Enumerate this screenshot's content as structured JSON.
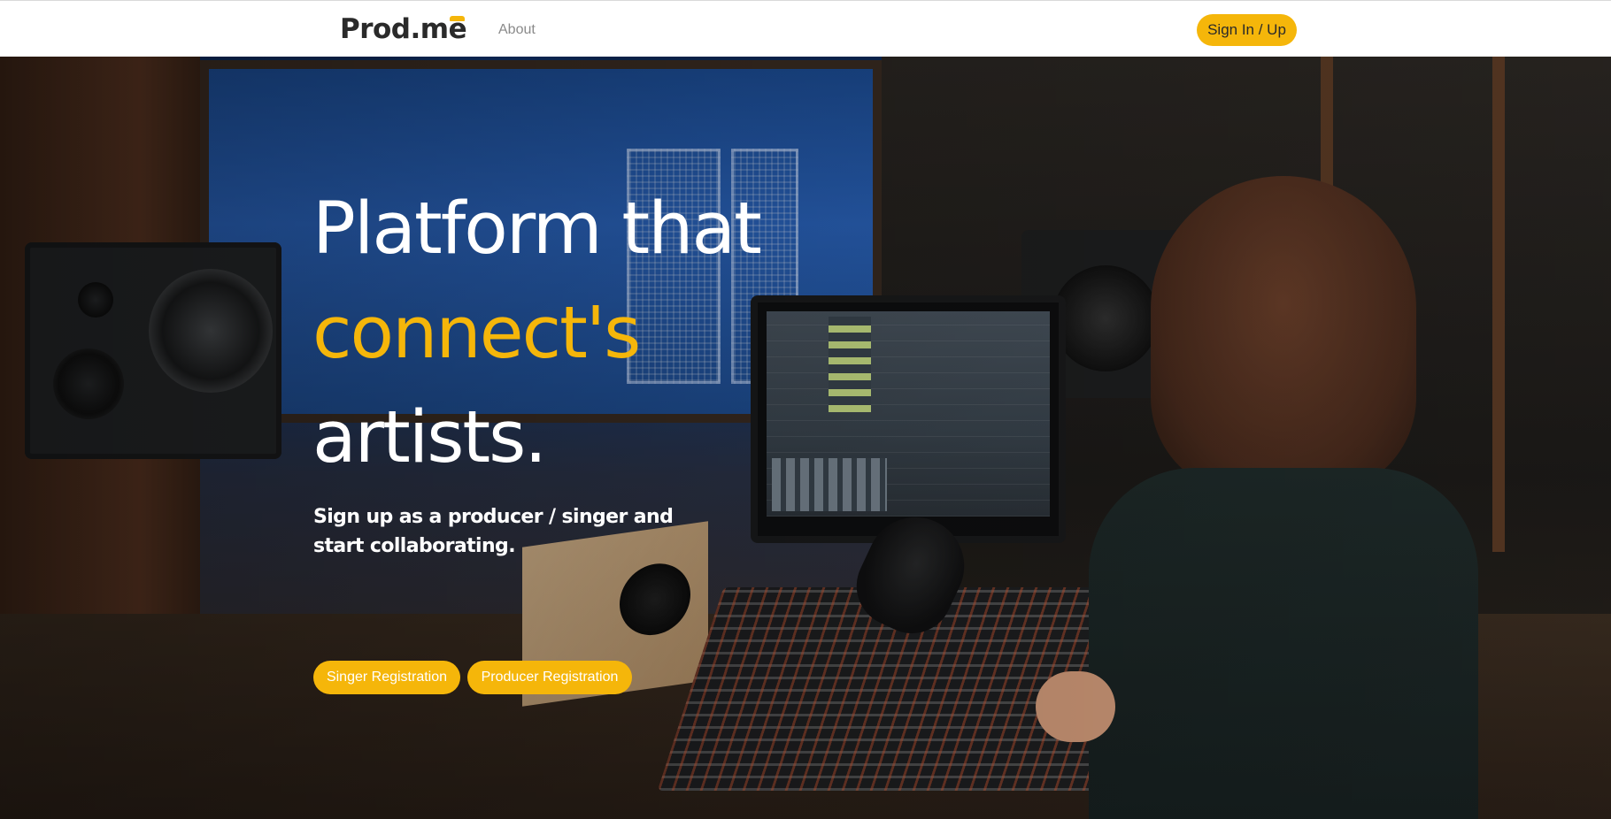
{
  "navbar": {
    "logo_text_main": "Prod.m",
    "logo_text_accent": "e",
    "about_label": "About",
    "sign_in_label": "Sign In / Up"
  },
  "hero": {
    "title_line1": "Platform that",
    "title_line2": "connect's",
    "title_line3": "artists.",
    "subtitle": "Sign up as a producer / singer and start collaborating.",
    "singer_button_label": "Singer Registration",
    "producer_button_label": "Producer Registration"
  },
  "colors": {
    "accent": "#f5b60a",
    "text_dark": "#2a2a2a",
    "text_muted": "#8a8a8a",
    "white": "#ffffff"
  }
}
